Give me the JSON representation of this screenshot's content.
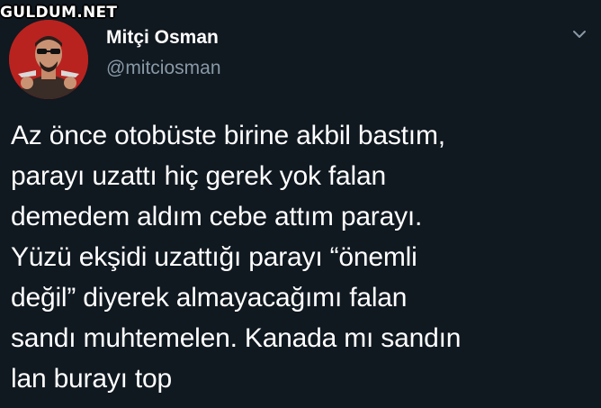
{
  "watermark": {
    "text": "GULDUM.NET"
  },
  "author": {
    "display_name": "Mitçi Osman",
    "handle": "@mitciosman",
    "avatar_icon": "avatar-portrait-icon"
  },
  "menu": {
    "icon": "chevron-down-icon"
  },
  "tweet": {
    "text": "Az önce otobüste birine akbil bastım,\nparayı uzattı hiç gerek yok falan\ndemedem aldım cebe attım parayı.\nYüzü ekşidi uzattığı parayı “önemli\ndeğil” diyerek almayacağımı falan\nsandı muhtemelen. Kanada mı sandın\nlan burayı top"
  },
  "colors": {
    "background": "#101820",
    "text_primary": "#ffffff",
    "text_secondary": "#8899a6",
    "avatar_background": "#b8231f"
  }
}
